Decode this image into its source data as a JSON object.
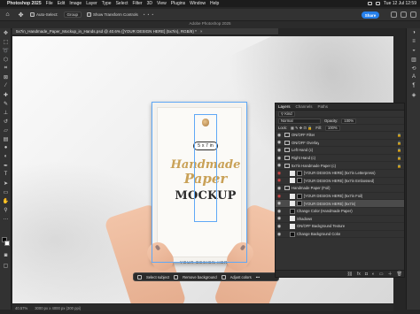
{
  "menubar": {
    "app_name": "Photoshop 2025",
    "items": [
      "File",
      "Edit",
      "Image",
      "Layer",
      "Type",
      "Select",
      "Filter",
      "3D",
      "View",
      "Plugins",
      "Window",
      "Help"
    ],
    "clock": "Tue 12 Jul 12:59"
  },
  "options": {
    "auto_select_label": "Auto-Select:",
    "auto_select_value": "Group",
    "transform_label": "Show Transform Controls",
    "share_label": "Share"
  },
  "window_title": "Adobe Photoshop 2025",
  "document": {
    "tab_title": "5x7in_Handmade_Paper_Mockup_in_Hands.psd @ 40.6% ([YOUR DESIGN HERE] (5x7in), RGB/8) *"
  },
  "canvas": {
    "size_badge": "5 x 7 in",
    "script_line1": "Handmade",
    "script_line2": "Paper",
    "headline": "MOCKUP",
    "design_here": "YOUR DESIGN HERE"
  },
  "context_bar": {
    "select_subject": "Select subject",
    "remove_background": "Remove background",
    "adjust_colors": "Adjust colors"
  },
  "status": {
    "zoom": "40.57%",
    "doc_size": "3000 px x 4000 px (300 ppi)"
  },
  "layers_panel": {
    "tabs": [
      "Layers",
      "Channels",
      "Paths"
    ],
    "filter_kind": "Kind",
    "blend_mode": "Normal",
    "opacity_label": "Opacity:",
    "opacity_value": "100%",
    "lock_label": "Lock:",
    "fill_label": "Fill:",
    "fill_value": "100%",
    "layers": [
      {
        "name": "ON/OFF Filter",
        "kind": "folder",
        "eye_color": "#cfcfcf",
        "selected": false,
        "locked": true
      },
      {
        "name": "ON/OFF Overlay",
        "kind": "folder",
        "eye_color": "#cfcfcf",
        "selected": false,
        "locked": true
      },
      {
        "name": "Left Hand (c)",
        "kind": "folder",
        "eye_color": "#cfcfcf",
        "selected": false,
        "locked": true
      },
      {
        "name": "Right Hand (c)",
        "kind": "folder",
        "eye_color": "#cfcfcf",
        "selected": false,
        "locked": true
      },
      {
        "name": "5x7in Handmade Paper (c)",
        "kind": "folder",
        "eye_color": "#cfcfcf",
        "selected": false,
        "locked": true
      },
      {
        "name": "[YOUR DESIGN HERE] (5x7in Letterpress)",
        "kind": "smart",
        "eye_color": "#e04848",
        "selected": false,
        "locked": false
      },
      {
        "name": "[YOUR DESIGN HERE] (5x7in Embossed)",
        "kind": "smart",
        "eye_color": "#e04848",
        "selected": false,
        "locked": false
      },
      {
        "name": "Handmade Paper (Foil)",
        "kind": "folder",
        "eye_color": "#cfcfcf",
        "selected": false,
        "locked": false
      },
      {
        "name": "[YOUR DESIGN HERE] (5x7in Foil)",
        "kind": "smart",
        "eye_color": "#e04848",
        "selected": false,
        "locked": false
      },
      {
        "name": "[YOUR DESIGN HERE] (5x7in)",
        "kind": "smart",
        "eye_color": "#cfcfcf",
        "selected": true,
        "locked": false
      },
      {
        "name": "Change Color (Handmade Paper)",
        "kind": "adjust",
        "eye_color": "#cfcfcf",
        "selected": false,
        "locked": false
      },
      {
        "name": "Shadows",
        "kind": "plain",
        "eye_color": "#cfcfcf",
        "selected": false,
        "locked": false
      },
      {
        "name": "ON/OFF Background Texture",
        "kind": "plain",
        "eye_color": "#cfcfcf",
        "selected": false,
        "locked": false
      },
      {
        "name": "Change Background Color",
        "kind": "adjust",
        "eye_color": "#cfcfcf",
        "selected": false,
        "locked": false
      }
    ]
  },
  "colors": {
    "accent": "#2680eb",
    "selection": "#5fa8f6",
    "gold": "#c9a157"
  }
}
